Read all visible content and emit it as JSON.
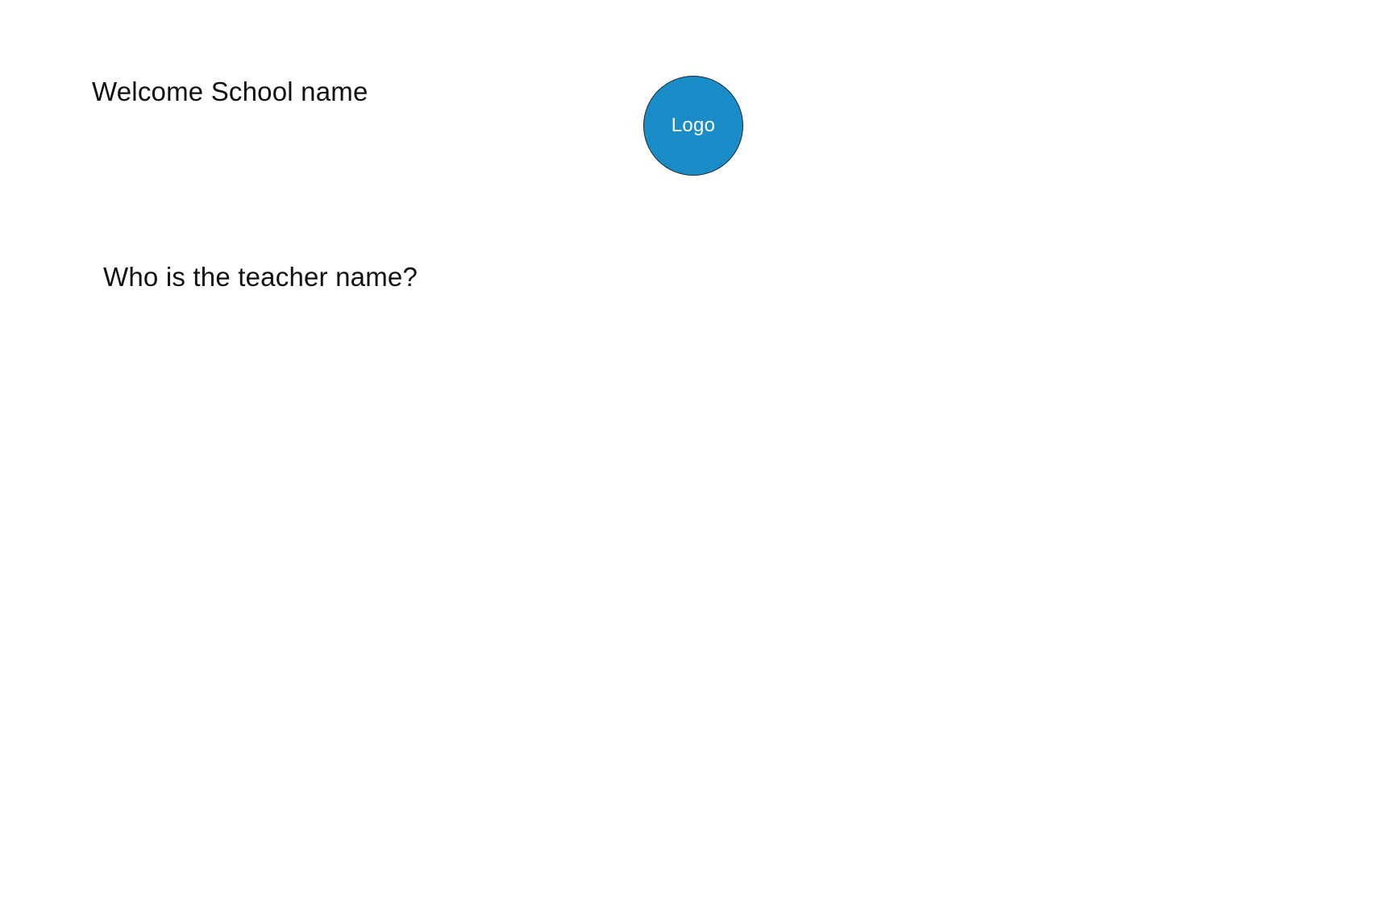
{
  "header": {
    "welcome_text": "Welcome School name"
  },
  "logo": {
    "label": "Logo",
    "color": "#1a8cc7"
  },
  "main": {
    "question": "Who is the teacher name?"
  }
}
